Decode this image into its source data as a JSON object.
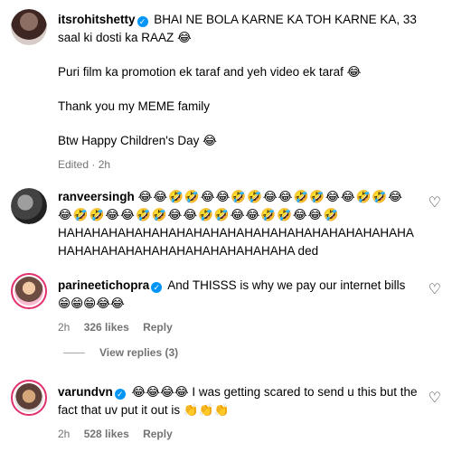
{
  "comments": [
    {
      "username": "itsrohitshetty",
      "text_lines": [
        "BHAI NE BOLA KARNE KA TOH KARNE KA, 33 saal ki dosti ka RAAZ 😂",
        "Puri film ka promotion ek taraf and yeh video ek taraf 😂",
        "Thank you my MEME family",
        "Btw Happy Children's Day 😂"
      ],
      "meta": "Edited · 2h"
    },
    {
      "username": "ranveersingh",
      "emojis": "😂😂🤣🤣😂😂🤣🤣😂😂🤣🤣😂😂🤣🤣😂😂🤣🤣😂😂🤣🤣😂😂🤣🤣😂😂🤣🤣😂😂🤣",
      "text": "HAHAHAHAHAHAHAHAHAHAHAHAHAHAHAHAHAHAHAHAHAHAHAHAHAHAHAHAHAHAHAHAHAHAHA ded"
    },
    {
      "username": "parineetichopra",
      "text": "And THISSS is why we pay our internet bills 😁😁😁😂😂",
      "time": "2h",
      "likes": "326 likes",
      "reply": "Reply"
    },
    {
      "username": "varundvn",
      "text": "😂😂😂😂 I was getting scared to send u this but the fact that uv put it out is 👏👏👏",
      "time": "2h",
      "likes": "528 likes",
      "reply": "Reply"
    }
  ],
  "view_replies": "View replies (3)",
  "verified_mark": "✓",
  "heart_glyph": "♡"
}
